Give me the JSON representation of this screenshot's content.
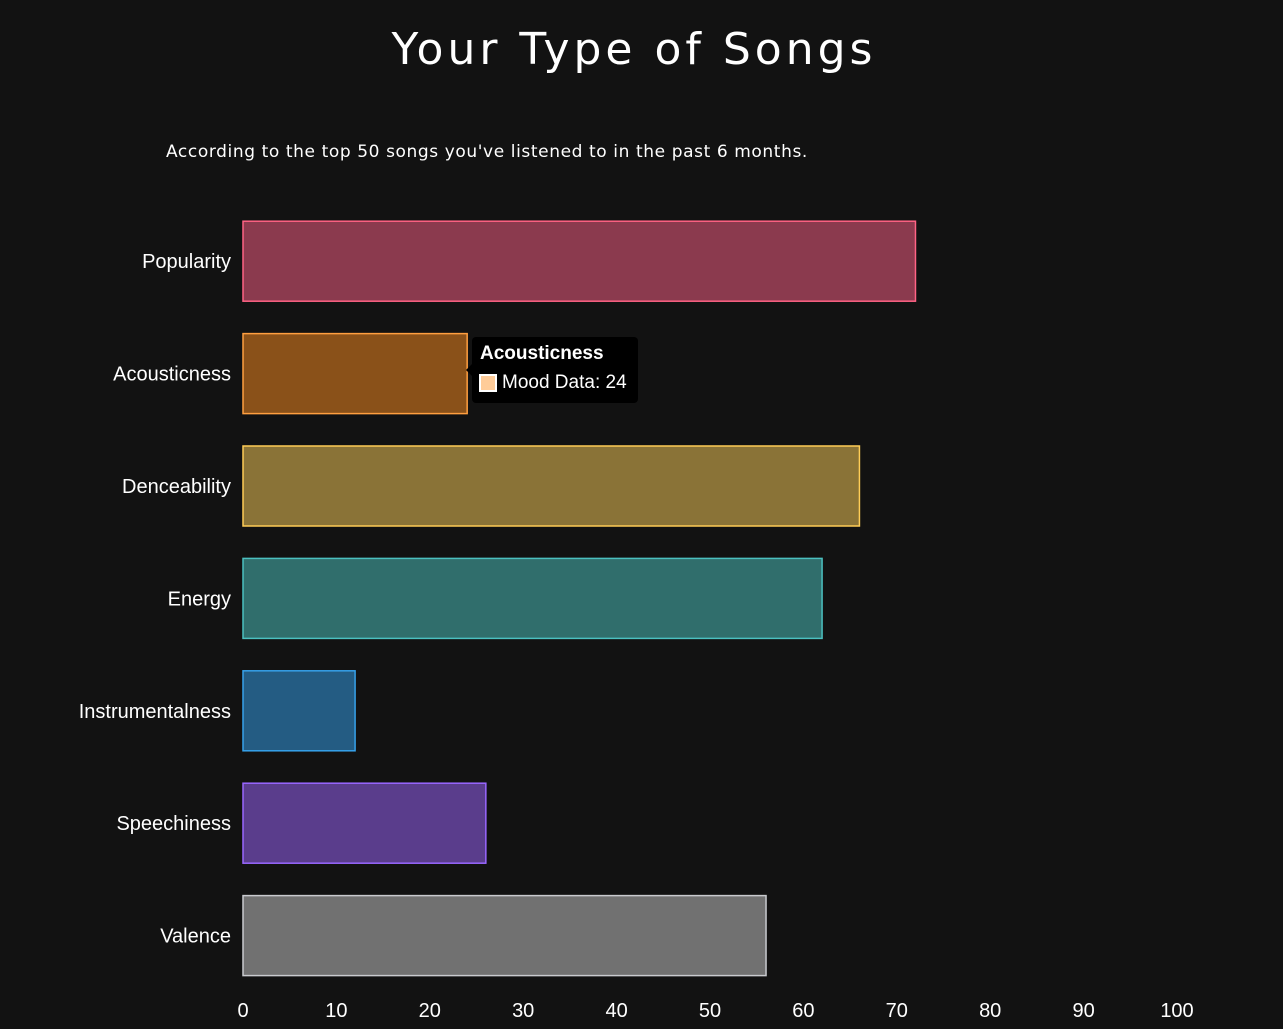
{
  "page": {
    "title": "Your Type of Songs",
    "subtitle": "According to the top 50 songs you've listened to in the past 6 months."
  },
  "chart_data": {
    "type": "bar",
    "orientation": "horizontal",
    "categories": [
      "Popularity",
      "Acousticness",
      "Denceability",
      "Energy",
      "Instrumentalness",
      "Speechiness",
      "Valence"
    ],
    "series": [
      {
        "name": "Mood Data",
        "values": [
          72,
          24,
          66,
          62,
          12,
          26,
          56
        ]
      }
    ],
    "xlim": [
      0,
      100
    ],
    "xticks": [
      0,
      10,
      20,
      30,
      40,
      50,
      60,
      70,
      80,
      90,
      100
    ],
    "grid": false,
    "legend": "none",
    "colors": {
      "fills": [
        "#8b3a4e",
        "#8a5119",
        "#8a7337",
        "#306e6c",
        "#245c83",
        "#5a3d8c",
        "#717171"
      ],
      "borders": [
        "#ff6384",
        "#ff9f40",
        "#ffcd56",
        "#4bc0c0",
        "#36a2eb",
        "#9966ff",
        "#c9cbcf"
      ]
    }
  },
  "tooltip": {
    "title": "Acousticness",
    "label": "Mood Data: 24",
    "swatch_color": "#ffcc99"
  }
}
